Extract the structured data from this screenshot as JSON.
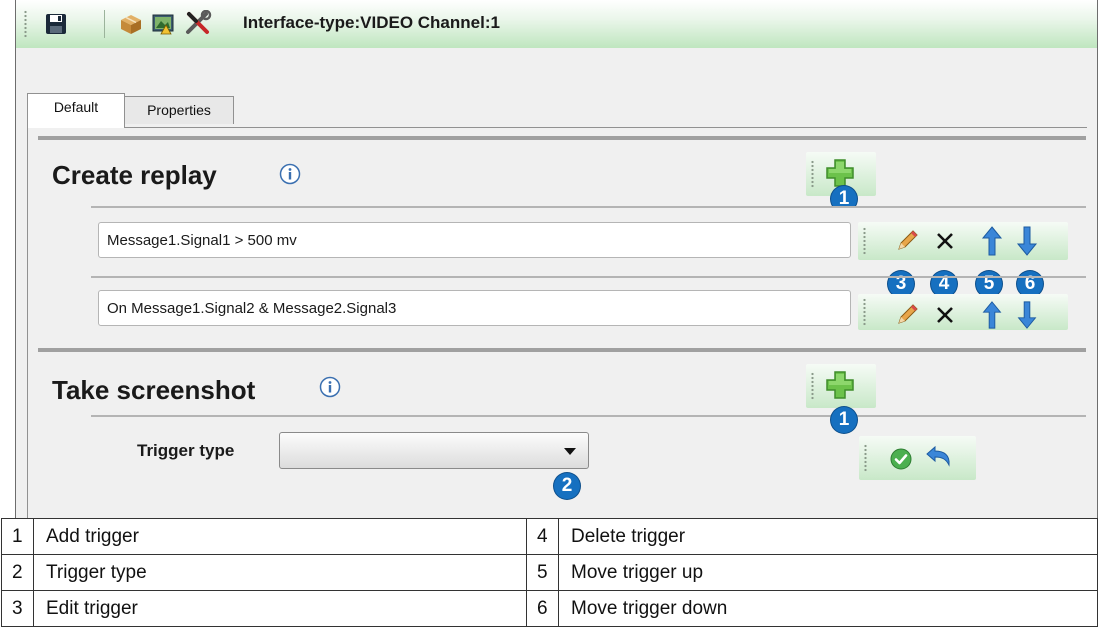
{
  "toolbar": {
    "title": "Interface-type:VIDEO Channel:1",
    "icons": [
      "save-icon",
      "package-icon",
      "monitor-icon",
      "tools-icon"
    ]
  },
  "tabs": [
    {
      "label": "Default",
      "selected": true
    },
    {
      "label": "Properties",
      "selected": false
    }
  ],
  "sections": {
    "create_replay": {
      "title": "Create replay",
      "triggers": [
        "Message1.Signal1  >  500 mv",
        "On Message1.Signal2 & Message2.Signal3"
      ]
    },
    "take_screenshot": {
      "title": "Take screenshot",
      "trigger_type_label": "Trigger type",
      "trigger_type_value": ""
    }
  },
  "badges": {
    "add_create": "1",
    "edit": "3",
    "delete": "4",
    "up": "5",
    "down": "6",
    "add_screenshot": "1",
    "trigger_type": "2"
  },
  "legend": [
    {
      "n1": "1",
      "l1": "Add trigger",
      "n2": "4",
      "l2": "Delete trigger"
    },
    {
      "n1": "2",
      "l1": "Trigger type",
      "n2": "5",
      "l2": "Move trigger up"
    },
    {
      "n1": "3",
      "l1": "Edit trigger",
      "n2": "6",
      "l2": "Move trigger down"
    }
  ],
  "colors": {
    "accent_green": "#bfe6bf",
    "badge_blue": "#1670c0",
    "arrow_blue": "#3a86d8"
  }
}
